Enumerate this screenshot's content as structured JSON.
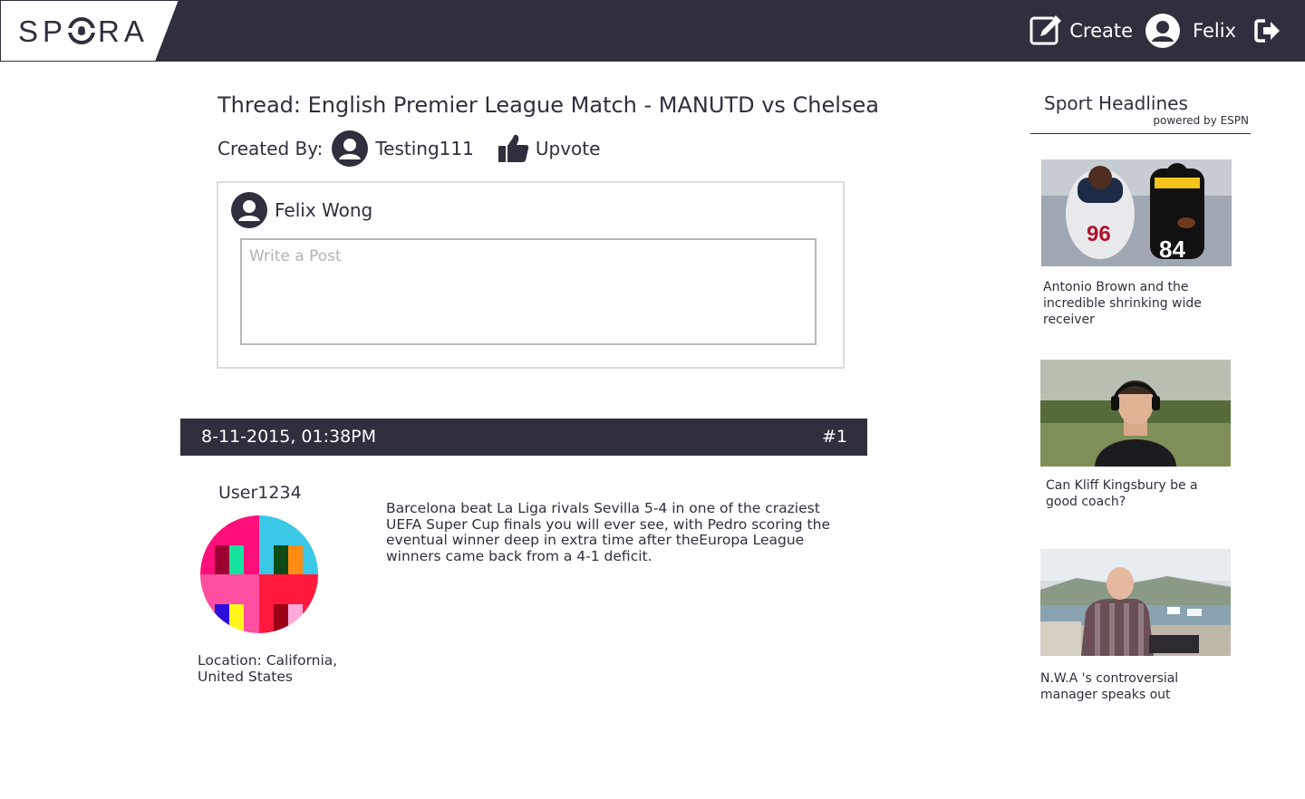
{
  "brand": {
    "name": "SPORA"
  },
  "nav": {
    "create_label": "Create",
    "user_label": "Felix",
    "icons": {
      "create": "edit-icon",
      "user": "user-icon",
      "logout": "logout-icon"
    }
  },
  "thread": {
    "title": "Thread: English Premier League Match - MANUTD vs Chelsea",
    "created_by_label": "Created By:",
    "creator": "Testing111",
    "upvote_label": "Upvote"
  },
  "composer": {
    "author": "Felix Wong",
    "placeholder": "Write a Post"
  },
  "post": {
    "date": "8-11-2015, 01:38PM",
    "number": "#1",
    "username": "User1234",
    "location": "Location: California, United States",
    "body": "Barcelona beat La Liga rivals Sevilla 5-4 in one of the craziest UEFA Super Cup finals you will ever see, with Pedro scoring the eventual winner deep in extra time after theEuropa League winners came back from a 4-1 deficit."
  },
  "sidebar": {
    "title": "Sport Headlines",
    "powered_by": "powered by ESPN",
    "headlines": [
      {
        "caption": "Antonio Brown and the incredible shrinking wide receiver"
      },
      {
        "caption": "Can Kliff Kingsbury be a good coach?"
      },
      {
        "caption": "N.W.A 's controversial manager speaks out"
      }
    ]
  },
  "colors": {
    "header": "#2f2f3e",
    "text": "#2f2f3e",
    "border": "#dcdcdc"
  }
}
